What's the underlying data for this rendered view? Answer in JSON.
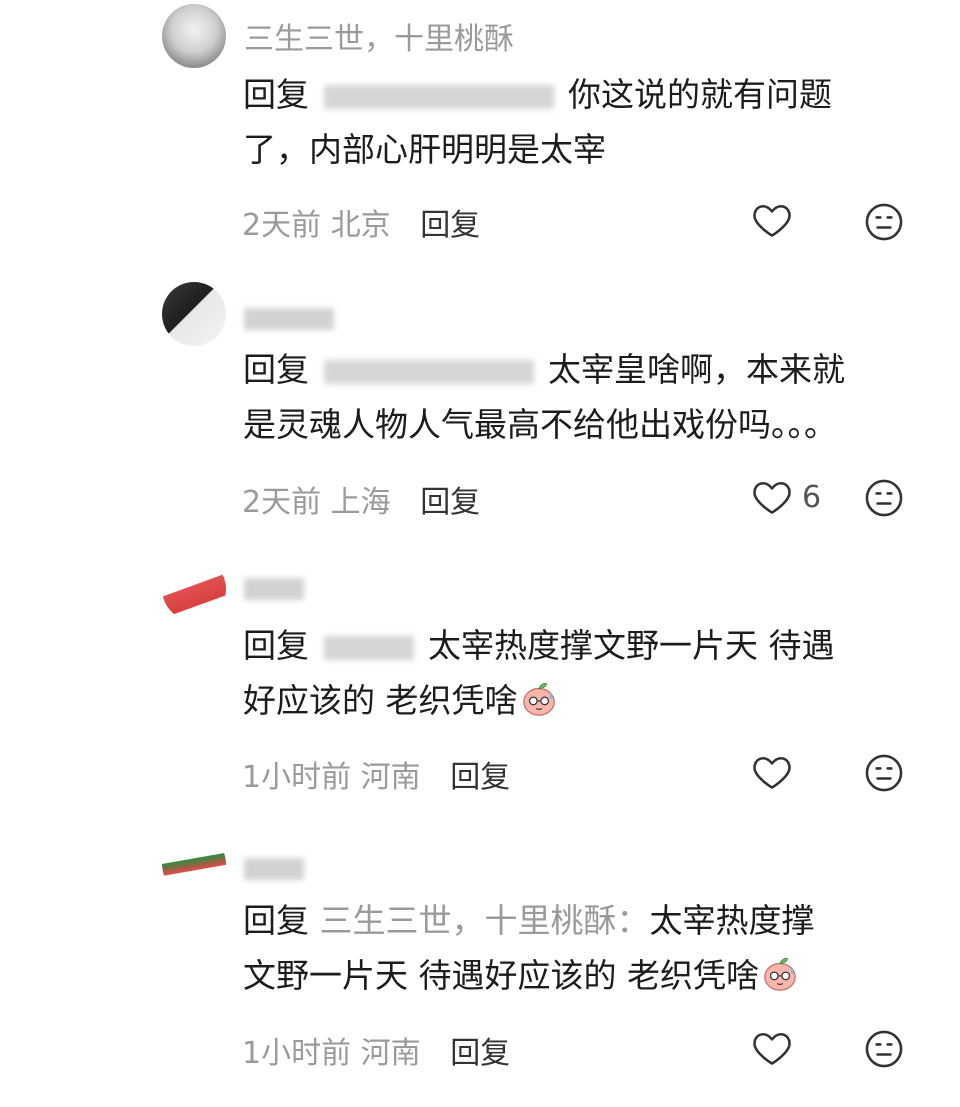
{
  "reply_label": "回复",
  "comments": [
    {
      "username": "三生三世，十里桃酥",
      "mention": "",
      "text_line1": "你这说的就有问题",
      "text_line2": "了，内部心肝明明是太宰",
      "time": "2天前",
      "location": "北京",
      "reply_button": "回复",
      "likes": ""
    },
    {
      "username": "",
      "mention": "",
      "text_line1": "太宰皇啥啊，本来就",
      "text_line2": "是灵魂人物人气最高不给他出戏份吗。。。",
      "time": "2天前",
      "location": "上海",
      "reply_button": "回复",
      "likes": "6"
    },
    {
      "username": "",
      "mention": "",
      "text_line1": "太宰热度撑文野一片天 待遇",
      "text_line2": "好应该的 老织凭啥",
      "time": "1小时前",
      "location": "河南",
      "reply_button": "回复",
      "likes": ""
    },
    {
      "username": "",
      "mention": "三生三世，十里桃酥：",
      "text_line1": "太宰热度撑",
      "text_line2": "文野一片天 待遇好应该的 老织凭啥",
      "time": "1小时前",
      "location": "河南",
      "reply_button": "回复",
      "likes": ""
    }
  ],
  "icons": {
    "like": "heart-outline-icon",
    "dislike": "meh-face-icon",
    "emoji": "sweating-peach-emoji"
  },
  "colors": {
    "text": "#1c1c1c",
    "muted": "#9a9a9a",
    "icon": "#333333"
  }
}
